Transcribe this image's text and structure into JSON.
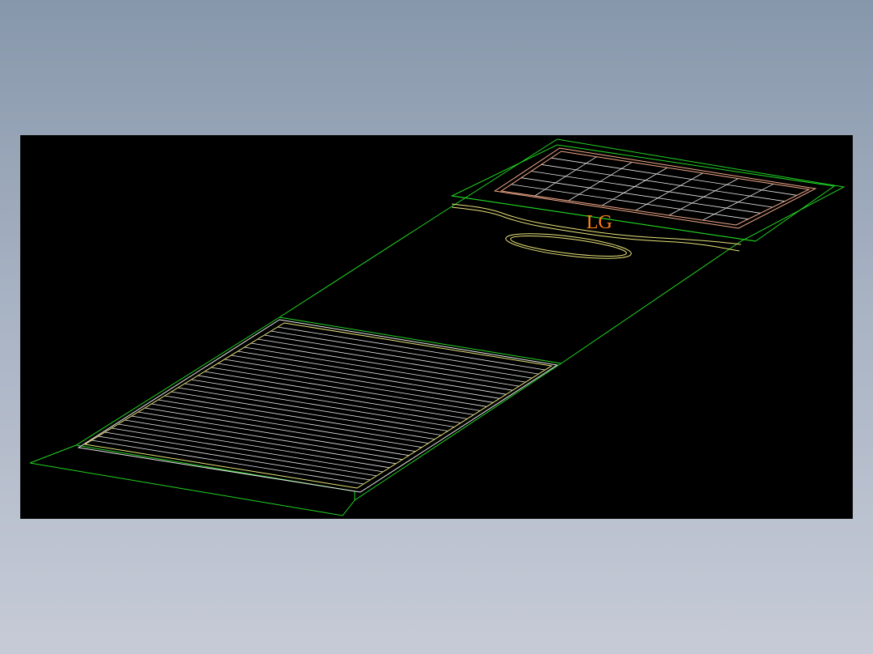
{
  "drawing": {
    "brand_label": "LG",
    "colors": {
      "background": "#000000",
      "outline": "#22d422",
      "detail": "#e8e37a",
      "grille": "#e8e8e8",
      "panel": "#f0a888",
      "brand": "#ff7f1a"
    }
  }
}
